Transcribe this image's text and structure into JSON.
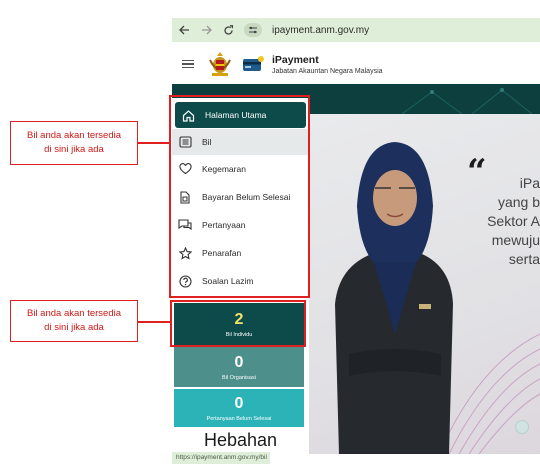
{
  "browser": {
    "url": "ipayment.anm.gov.my"
  },
  "header": {
    "title": "iPayment",
    "subtitle": "Jabatan Akauntan Negara Malaysia"
  },
  "sidebar": {
    "items": [
      {
        "label": "Halaman Utama",
        "icon": "home-icon"
      },
      {
        "label": "Bil",
        "icon": "bill-icon"
      },
      {
        "label": "Kegemaran",
        "icon": "heart-icon"
      },
      {
        "label": "Bayaran Belum Selesai",
        "icon": "pending-icon"
      },
      {
        "label": "Pertanyaan",
        "icon": "chat-icon"
      },
      {
        "label": "Penarafan",
        "icon": "star-icon"
      },
      {
        "label": "Soalan Lazim",
        "icon": "help-icon"
      }
    ]
  },
  "tiles": [
    {
      "count": "2",
      "label": "Bil Individu",
      "color": "#0d4b4b",
      "count_color": "#f3e36a"
    },
    {
      "count": "0",
      "label": "Bil Organisasi",
      "color": "#4d8f8a"
    },
    {
      "count": "0",
      "label": "Pertanyaan Belum Selesai",
      "color": "#2bb3b8"
    }
  ],
  "hero": {
    "lines": [
      "iPa",
      "yang b",
      "Sektor A",
      "mewuju",
      "serta"
    ]
  },
  "hebahan": "Hebahan",
  "status_url": "https://ipayment.anm.gov.my/bil",
  "annotations": {
    "callout_1": [
      "Bil anda akan tersedia",
      "di sini jika ada"
    ],
    "callout_2": [
      "Bil anda akan tersedia",
      "di sini jika ada"
    ],
    "color": "#e02020"
  }
}
